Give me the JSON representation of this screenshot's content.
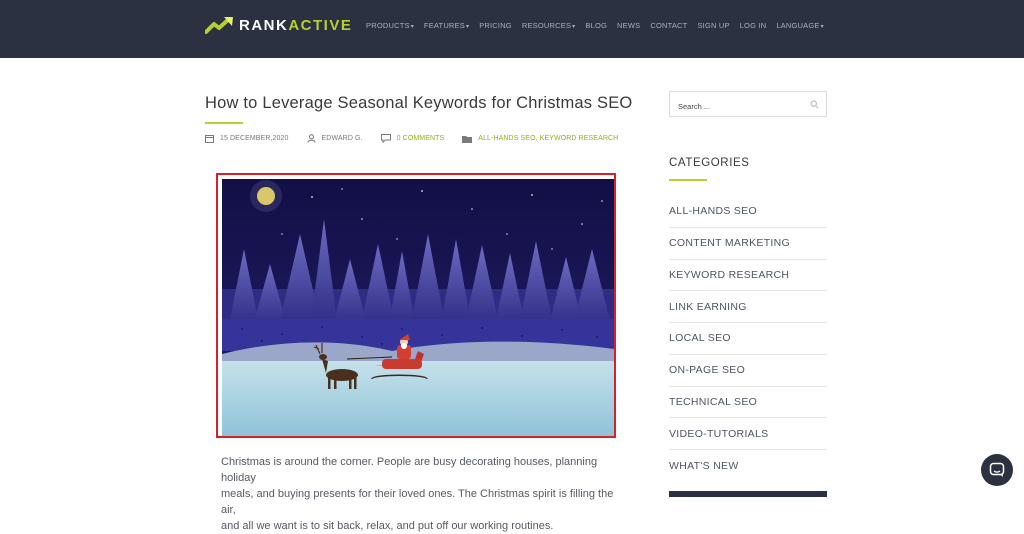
{
  "brand": {
    "name_part1": "RANK",
    "name_part2": "ACTIVE",
    "colors": {
      "header_bg": "#2b3140",
      "accent": "#b7d02f",
      "accent_text": "#8fb10b"
    }
  },
  "nav": {
    "items": [
      {
        "label": "PRODUCTS",
        "has_dropdown": true
      },
      {
        "label": "FEATURES",
        "has_dropdown": true
      },
      {
        "label": "PRICING",
        "has_dropdown": false
      },
      {
        "label": "RESOURCES",
        "has_dropdown": true
      },
      {
        "label": "BLOG",
        "has_dropdown": false
      },
      {
        "label": "NEWS",
        "has_dropdown": false
      },
      {
        "label": "CONTACT",
        "has_dropdown": false
      },
      {
        "label": "SIGN UP",
        "has_dropdown": false
      },
      {
        "label": "LOG IN",
        "has_dropdown": false
      },
      {
        "label": "LANGUAGE",
        "has_dropdown": true
      }
    ],
    "caret": "▾"
  },
  "article": {
    "title": "How to Leverage Seasonal Keywords for Christmas SEO",
    "meta": {
      "date": "15 DECEMBER,2020",
      "author": "EDWARD G.",
      "comments": "0 COMMENTS",
      "categories": "ALL-HANDS SEO, KEYWORD RESEARCH"
    },
    "paragraph_lines": [
      "Christmas is around the corner. People are busy decorating houses, planning holiday",
      "meals, and buying presents for their loved ones. The Christmas spirit is filling the air,",
      "and all we want is to sit back, relax, and put off our working routines."
    ]
  },
  "sidebar": {
    "search_placeholder": "Search ...",
    "categories_heading": "CATEGORIES",
    "categories": [
      "ALL-HANDS SEO",
      "CONTENT MARKETING",
      "KEYWORD RESEARCH",
      "LINK EARNING",
      "LOCAL SEO",
      "ON-PAGE SEO",
      "TECHNICAL SEO",
      "VIDEO-TUTORIALS",
      "WHAT'S NEW"
    ]
  },
  "icons": {
    "logo": "rankactive-arrow-logo",
    "date": "calendar-icon",
    "author": "user-icon",
    "comments": "comment-icon",
    "categories": "folder-icon",
    "search": "search-icon",
    "chat": "chat-icon"
  }
}
